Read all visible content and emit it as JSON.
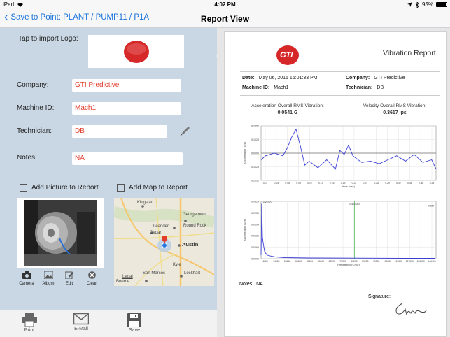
{
  "statusbar": {
    "device": "iPad",
    "time": "4:02 PM",
    "battery": "95%",
    "battery_fraction": 0.95
  },
  "navbar": {
    "back_label": "Save to Point: PLANT / PUMP11 / P1A",
    "title": "Report View"
  },
  "form": {
    "logo_label": "Tap to import Logo:",
    "logo_text": "GTI",
    "company_label": "Company:",
    "company_value": "GTI Predictive",
    "machine_label": "Machine ID:",
    "machine_value": "Mach1",
    "technician_label": "Technician:",
    "technician_value": "DB",
    "notes_label": "Notes:",
    "notes_value": "NA",
    "add_picture_label": "Add Picture to Report",
    "add_map_label": "Add Map to Report"
  },
  "photo_tools": [
    {
      "label": "Camera",
      "icon": "camera-icon"
    },
    {
      "label": "Album",
      "icon": "album-icon"
    },
    {
      "label": "Edit",
      "icon": "edit-icon"
    },
    {
      "label": "Clear",
      "icon": "clear-icon"
    }
  ],
  "map": {
    "places": [
      "Kingslad",
      "Georgetown",
      "Leander",
      "Round Rock",
      "Cedar",
      "Austin",
      "Kyle",
      "San Marcos",
      "Lockhart",
      "Boerne"
    ],
    "legal": "Legal"
  },
  "toolbar": [
    {
      "label": "Print",
      "icon": "printer-icon"
    },
    {
      "label": "E-Mail",
      "icon": "mail-icon"
    },
    {
      "label": "Save",
      "icon": "save-icon"
    }
  ],
  "report": {
    "title": "Vibration Report",
    "date_label": "Date:",
    "date_value": "May 06, 2016  16:01:33 PM",
    "company_label": "Company:",
    "company_value": "GTI Predictive",
    "machine_label": "Machine ID:",
    "machine_value": "Mach1",
    "technician_label": "Technician:",
    "technician_value": "DB",
    "accel_label": "Acceleration Overall RMS Vibration:",
    "accel_value": "0.0541 G",
    "velocity_label": "Velocity Overall RMS Vibration:",
    "velocity_value": "0.3617 ips",
    "notes_label": "Notes:",
    "notes_value": "NA",
    "signature_label": "Signature:",
    "colors": {
      "trace": "#3a3fd4",
      "accent": "#1a73d9",
      "field_text": "#e23b2a"
    }
  },
  "chart_data": [
    {
      "type": "line",
      "title": "",
      "xlabel": "time (sec)",
      "ylabel": "Acceleration (G's)",
      "xlim": [
        0,
        0.4
      ],
      "ylim": [
        -0.2052,
        0.2052
      ],
      "yticks": [
        "0.2052",
        "0.1026",
        "0.0000",
        "-0.1026",
        "-0.2052"
      ],
      "xticks": [
        "0.01",
        "0.04",
        "0.06",
        "0.09",
        "0.12",
        "0.14",
        "0.16",
        "0.19",
        "0.22",
        "0.24",
        "0.26",
        "0.29",
        "0.32",
        "0.34",
        "0.36",
        "0.38"
      ],
      "grid": true,
      "x": [
        0.0,
        0.01,
        0.03,
        0.05,
        0.06,
        0.07,
        0.08,
        0.09,
        0.1,
        0.11,
        0.13,
        0.15,
        0.17,
        0.18,
        0.19,
        0.2,
        0.21,
        0.23,
        0.25,
        0.27,
        0.29,
        0.31,
        0.33,
        0.35,
        0.37,
        0.39,
        0.4
      ],
      "y": [
        -0.05,
        -0.02,
        0.0,
        -0.02,
        0.04,
        0.12,
        0.18,
        0.05,
        -0.09,
        -0.06,
        -0.11,
        -0.05,
        -0.12,
        0.02,
        -0.01,
        0.06,
        -0.02,
        -0.07,
        -0.06,
        -0.08,
        -0.05,
        -0.02,
        -0.06,
        -0.01,
        -0.07,
        -0.05,
        -0.12
      ]
    },
    {
      "type": "line",
      "title": "",
      "xlabel": "Frequency (CPM)",
      "ylabel": "Acceleration (G's)",
      "xlim": [
        0,
        147000
      ],
      "ylim": [
        0,
        0.0324
      ],
      "yticks": [
        "0.0324",
        "0.0259",
        "0.0194",
        "0.0130",
        "0.0065",
        "0.0000"
      ],
      "xticks": [
        "4650",
        "14550",
        "23650",
        "33600",
        "43600",
        "53600",
        "63500",
        "73500",
        "80200",
        "89550",
        "99550",
        "109650",
        "119600",
        "127500",
        "136950",
        "146400"
      ],
      "annotations": [
        "600.000",
        "78400.000",
        "0.024"
      ],
      "grid": true,
      "x": [
        0,
        600,
        1200,
        2000,
        3000,
        5000,
        8000,
        12000,
        20000,
        40000,
        80000,
        120000,
        146400
      ],
      "y": [
        0.002,
        0.031,
        0.012,
        0.008,
        0.004,
        0.002,
        0.0015,
        0.001,
        0.0006,
        0.0004,
        0.0003,
        0.0002,
        0.0002
      ]
    }
  ]
}
